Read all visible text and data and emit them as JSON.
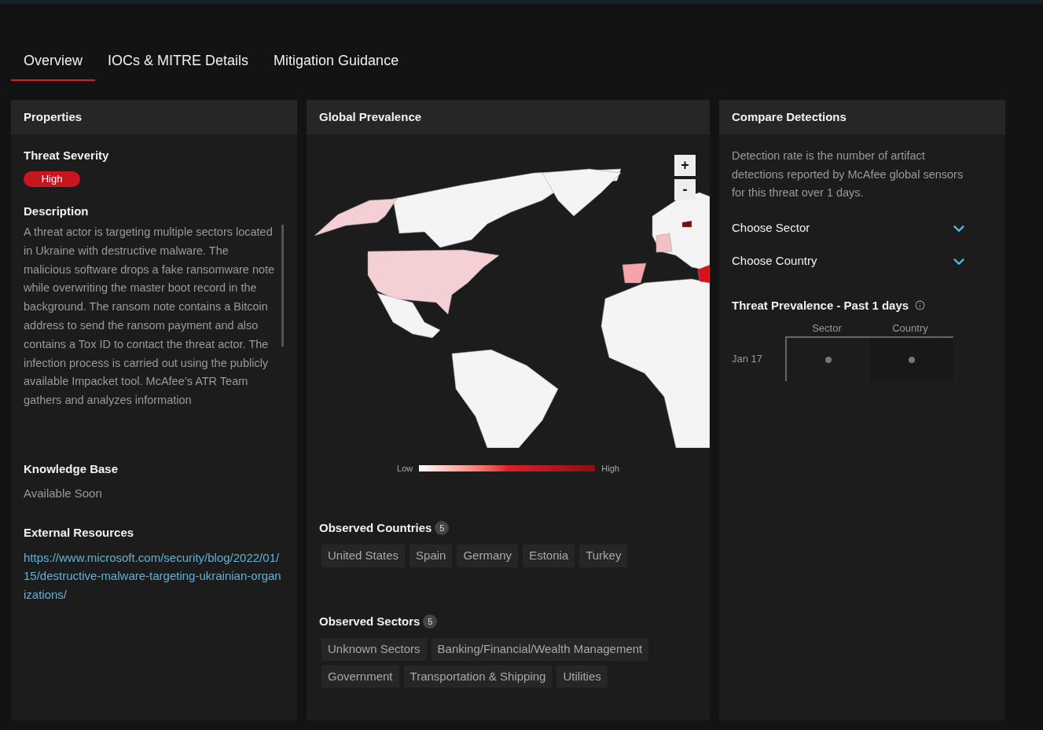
{
  "tabs": [
    {
      "label": "Overview",
      "selected": true
    },
    {
      "label": "IOCs & MITRE Details",
      "selected": false
    },
    {
      "label": "Mitigation Guidance",
      "selected": false
    }
  ],
  "properties": {
    "title": "Properties",
    "severity_label": "Threat Severity",
    "severity": "High",
    "description_label": "Description",
    "description": "A threat actor is targeting multiple sectors located in Ukraine with destructive malware. The malicious software drops a fake ransomware note while overwriting the master boot record in the background. The ransom note contains a Bitcoin address to send the ransom payment and also contains a Tox ID to contact the threat actor. The infection process is carried out using the publicly available Impacket tool. McAfee’s ATR Team gathers and analyzes information",
    "knowledge_label": "Knowledge Base",
    "knowledge_value": "Available Soon",
    "resources_label": "External Resources",
    "resource_link": "https://www.microsoft.com/security/blog/2022/01/15/destructive-malware-targeting-ukrainian-organizations/"
  },
  "prevalence": {
    "title": "Global Prevalence",
    "zoom_in": "+",
    "zoom_out": "-",
    "legend_low": "Low",
    "legend_high": "High",
    "countries_label": "Observed Countries",
    "countries_count": "5",
    "countries": [
      "United States",
      "Spain",
      "Germany",
      "Estonia",
      "Turkey"
    ],
    "sectors_label": "Observed Sectors",
    "sectors_count": "5",
    "sectors": [
      "Unknown Sectors",
      "Banking/Financial/Wealth Management",
      "Government",
      "Transportation & Shipping",
      "Utilities"
    ]
  },
  "compare": {
    "title": "Compare Detections",
    "note": "Detection rate is the number of artifact detections reported by McAfee global sensors for this threat over 1 days.",
    "dropdowns": [
      "Choose Sector",
      "Choose Country"
    ],
    "chart_title": "Threat Prevalence - Past 1 days",
    "columns": [
      "Sector",
      "Country"
    ],
    "rows": [
      "Jan 17"
    ]
  }
}
